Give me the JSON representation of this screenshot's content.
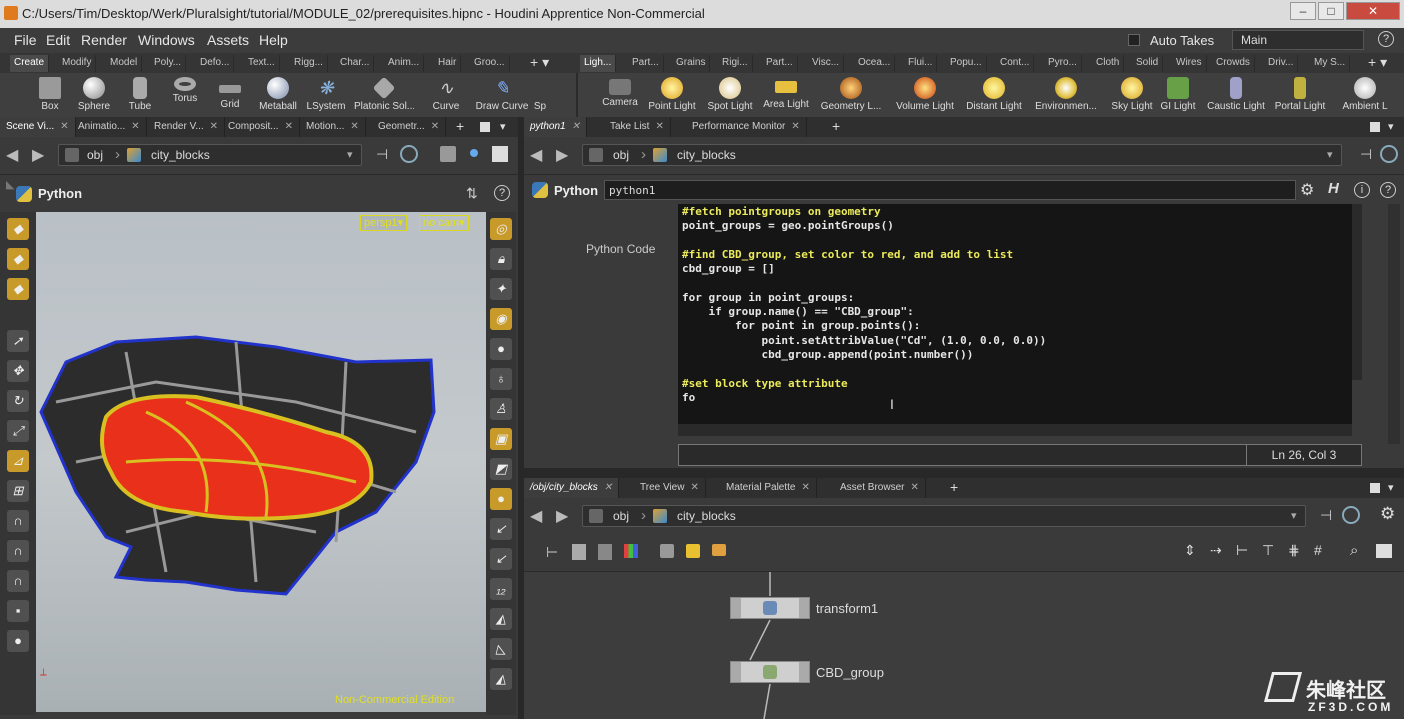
{
  "window": {
    "title": "C:/Users/Tim/Desktop/Werk/Pluralsight/tutorial/MODULE_02/prerequisites.hipnc - Houdini Apprentice Non-Commercial",
    "buttons": [
      "minimize-icon",
      "maximize-icon",
      "close-icon"
    ]
  },
  "menu": {
    "items": [
      "File",
      "Edit",
      "Render",
      "Windows",
      "Assets",
      "Help"
    ],
    "auto_takes": "Auto Takes",
    "desktop": "Main"
  },
  "shelf_tabs_left": [
    "Create",
    "Modify",
    "Model",
    "Poly...",
    "Defo...",
    "Text...",
    "Rigg...",
    "Char...",
    "Anim...",
    "Hair",
    "Groo..."
  ],
  "shelf_tabs_right": [
    "Ligh...",
    "Part...",
    "Grains",
    "Rigi...",
    "Part...",
    "Visc...",
    "Ocea...",
    "Flui...",
    "Popu...",
    "Cont...",
    "Pyro...",
    "Cloth",
    "Solid",
    "Wires",
    "Crowds",
    "Driv...",
    "My S..."
  ],
  "tools_left": [
    "Box",
    "Sphere",
    "Tube",
    "Torus",
    "Grid",
    "Metaball",
    "LSystem",
    "Platonic Sol...",
    "Curve",
    "Draw Curve",
    "Sp"
  ],
  "tools_right": [
    "Camera",
    "Point Light",
    "Spot Light",
    "Area Light",
    "Geometry L...",
    "Volume Light",
    "Distant Light",
    "Environmen...",
    "Sky Light",
    "GI Light",
    "Caustic Light",
    "Portal Light",
    "Ambient L"
  ],
  "left_pane": {
    "tabs": [
      "Scene Vi...",
      "Animatio...",
      "Render V...",
      "Composit...",
      "Motion...",
      "Geometr..."
    ],
    "path_obj": "obj",
    "path_node": "city_blocks",
    "header": "Python",
    "viewport_cam": "persp1",
    "viewport_nocam": "no cam",
    "watermark": "Non-Commercial Edition"
  },
  "right_top": {
    "tabs": [
      "python1",
      "Take List",
      "Performance Monitor"
    ],
    "path_obj": "obj",
    "path_node": "city_blocks",
    "node_type": "Python",
    "node_name": "python1",
    "param_label": "Python Code",
    "code_lines": [
      "#fetch pointgroups on geometry",
      "point_groups = geo.pointGroups()",
      "",
      "#find CBD_group, set color to red, and add to list",
      "cbd_group = []",
      "",
      "for group in point_groups:",
      "    if group.name() == \"CBD_group\":",
      "        for point in group.points():",
      "            point.setAttribValue(\"Cd\", (1.0, 0.0, 0.0))",
      "            cbd_group.append(point.number())",
      "",
      "#set block type attribute",
      "fo"
    ],
    "cursor_pos": "Ln 26, Col 3"
  },
  "right_bottom": {
    "tabs": [
      "/obj/city_blocks",
      "Tree View",
      "Material Palette",
      "Asset Browser"
    ],
    "path_obj": "obj",
    "path_node": "city_blocks",
    "nodes": [
      "transform1",
      "CBD_group"
    ]
  },
  "watermark_site": {
    "cn": "朱峰社区",
    "url": "ZF3D.COM"
  }
}
